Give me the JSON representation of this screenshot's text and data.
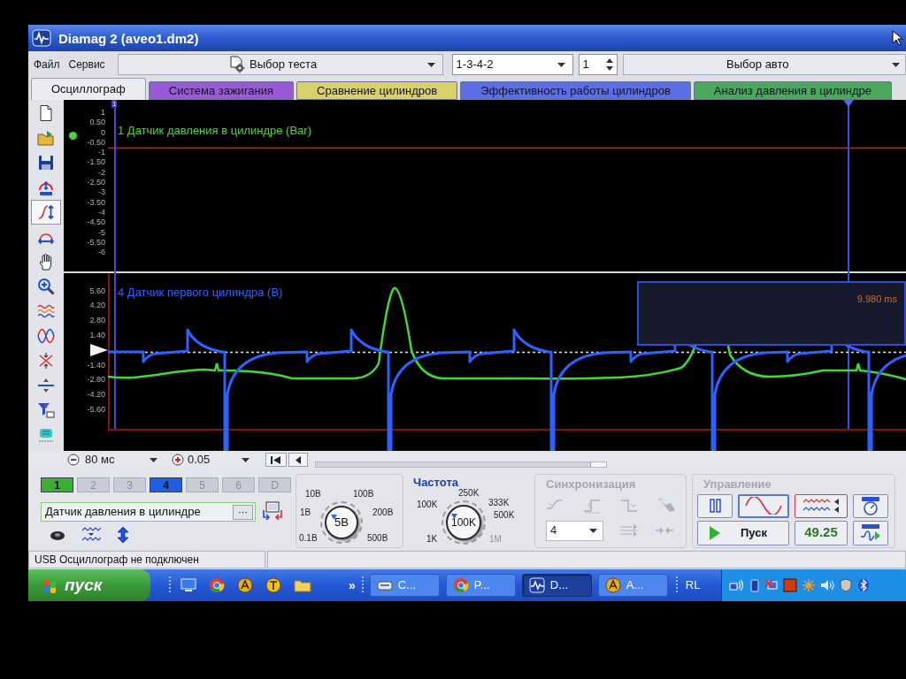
{
  "window": {
    "title": "Diamag 2 (aveo1.dm2)"
  },
  "menu": [
    "Файл",
    "Сервис"
  ],
  "selectors": {
    "test": "Выбор теста",
    "firing_order": "1-3-4-2",
    "cylinder": "1",
    "car": "Выбор авто"
  },
  "tabs": [
    {
      "label": "Осциллограф",
      "selected": true,
      "color": "#ececf0"
    },
    {
      "label": "Система зажигания",
      "selected": false,
      "color": "#9a5ad8"
    },
    {
      "label": "Сравнение цилиндров",
      "selected": false,
      "color": "#d8d06a"
    },
    {
      "label": "Эффективность работы цилиндров",
      "selected": false,
      "color": "#5a6fe6"
    },
    {
      "label": "Анализ давления в цилиндре",
      "selected": false,
      "color": "#4aa85a"
    }
  ],
  "tools": [
    {
      "kind": "new",
      "selected": false
    },
    {
      "kind": "open",
      "selected": false
    },
    {
      "kind": "save",
      "selected": false
    },
    {
      "kind": "auto",
      "selected": false
    },
    {
      "kind": "vscale",
      "selected": true
    },
    {
      "kind": "hscale",
      "selected": false
    },
    {
      "kind": "hand",
      "selected": false
    },
    {
      "kind": "zoom",
      "selected": false
    },
    {
      "kind": "stack",
      "selected": false
    },
    {
      "kind": "overlay",
      "selected": false
    },
    {
      "kind": "cross",
      "selected": false
    },
    {
      "kind": "split",
      "selected": false
    },
    {
      "kind": "filter",
      "selected": false
    },
    {
      "kind": "device",
      "selected": false
    }
  ],
  "plot": {
    "cursor_label": "1",
    "readout": "9.980 ms"
  },
  "charts": [
    {
      "title": "1 Датчик давления в цилиндре (Bar)",
      "color": "#44d836",
      "y_labels": [
        "1",
        "0.50",
        "0",
        "-0.50",
        "-1",
        "-1.50",
        "-2",
        "-2.50",
        "-3",
        "-3.50",
        "-4",
        "-4.50",
        "-5",
        "-5.50",
        "-6"
      ]
    },
    {
      "title": "4 Датчик первого цилиндра (В)",
      "color": "#2d62ff",
      "y_labels": [
        "5.60",
        "4.20",
        "2.80",
        "1.40",
        "-1.40",
        "-2.80",
        "-4.20",
        "-5.60"
      ]
    }
  ],
  "timebase": {
    "scale": "80 мс",
    "step": "0.05"
  },
  "channels": [
    {
      "label": "1",
      "on": true,
      "color": "#3cae34"
    },
    {
      "label": "2",
      "on": false
    },
    {
      "label": "3",
      "on": false
    },
    {
      "label": "4",
      "on": true,
      "color": "#1f5fe6"
    },
    {
      "label": "5",
      "on": false
    },
    {
      "label": "6",
      "on": false
    },
    {
      "label": "D",
      "on": false
    }
  ],
  "channel_name": {
    "value": "Датчик давления в цилиндре",
    "browse": "···"
  },
  "voltage_knob": {
    "value": "5В",
    "scale": [
      "10В",
      "100В",
      "1В",
      "200В",
      "0.1В",
      "500В"
    ]
  },
  "frequency_knob": {
    "title": "Частота",
    "value": "100K",
    "scale": [
      {
        "label": "250K",
        "disabled": false
      },
      {
        "label": "100K",
        "disabled": false
      },
      {
        "label": "333K",
        "disabled": false
      },
      {
        "label": "500K",
        "disabled": false
      },
      {
        "label": "1K",
        "disabled": false
      },
      {
        "label": "1M",
        "disabled": true
      }
    ]
  },
  "sync": {
    "title": "Синхронизация",
    "disabled": true,
    "channel": "4"
  },
  "control": {
    "title": "Управление",
    "start": "Пуск",
    "reading": "49.25"
  },
  "status_bar": [
    "USB Осциллограф не подключен"
  ],
  "taskbar": {
    "start": "пуск",
    "more": "»",
    "tasks": [
      {
        "label": "C...",
        "kind": "device",
        "selected": false
      },
      {
        "label": "P...",
        "kind": "browser",
        "selected": false
      },
      {
        "label": "D...",
        "kind": "scope",
        "selected": true
      },
      {
        "label": "A...",
        "kind": "disc",
        "selected": false
      }
    ],
    "toolbar_label": "RL"
  }
}
